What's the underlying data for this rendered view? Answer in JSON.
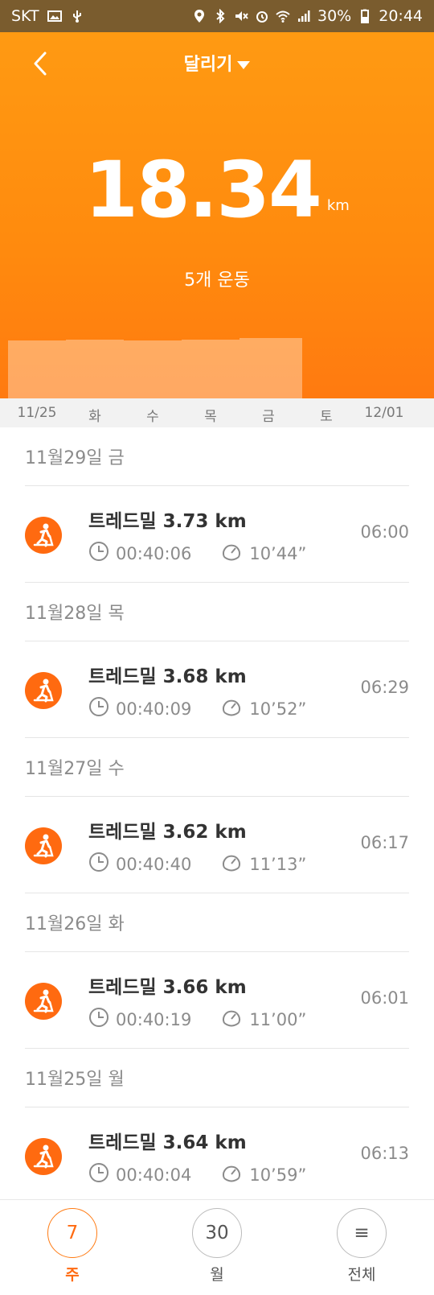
{
  "status_bar": {
    "carrier": "SKT",
    "battery": "30%",
    "time": "20:44"
  },
  "header": {
    "title": "달리기",
    "total_distance": "18.34",
    "distance_unit": "km",
    "workout_count": "5개 운동"
  },
  "chart_data": {
    "type": "bar",
    "categories": [
      "11/25",
      "화",
      "수",
      "목",
      "금",
      "토",
      "12/01"
    ],
    "values": [
      3.64,
      3.66,
      3.62,
      3.68,
      3.73,
      0,
      0
    ],
    "ylim": [
      0,
      4
    ],
    "grid": false
  },
  "days": [
    {
      "date": "11월29일 금",
      "activity": "트레드밀 3.73 km",
      "duration": "00:40:06",
      "pace": "10’44”",
      "start": "06:00"
    },
    {
      "date": "11월28일 목",
      "activity": "트레드밀 3.68 km",
      "duration": "00:40:09",
      "pace": "10’52”",
      "start": "06:29"
    },
    {
      "date": "11월27일 수",
      "activity": "트레드밀 3.62 km",
      "duration": "00:40:40",
      "pace": "11’13”",
      "start": "06:17"
    },
    {
      "date": "11월26일 화",
      "activity": "트레드밀 3.66 km",
      "duration": "00:40:19",
      "pace": "11’00”",
      "start": "06:01"
    },
    {
      "date": "11월25일 월",
      "activity": "트레드밀 3.64 km",
      "duration": "00:40:04",
      "pace": "10’59”",
      "start": "06:13"
    }
  ],
  "bottom_nav": {
    "tabs": [
      {
        "icon_text": "7",
        "label": "주"
      },
      {
        "icon_text": "30",
        "label": "월"
      },
      {
        "icon_text": "≡",
        "label": "전체"
      }
    ]
  },
  "colors": {
    "accent": "#ff6a10",
    "header_gradient_top": "#ff9a12",
    "header_gradient_bottom": "#ff7a10"
  }
}
